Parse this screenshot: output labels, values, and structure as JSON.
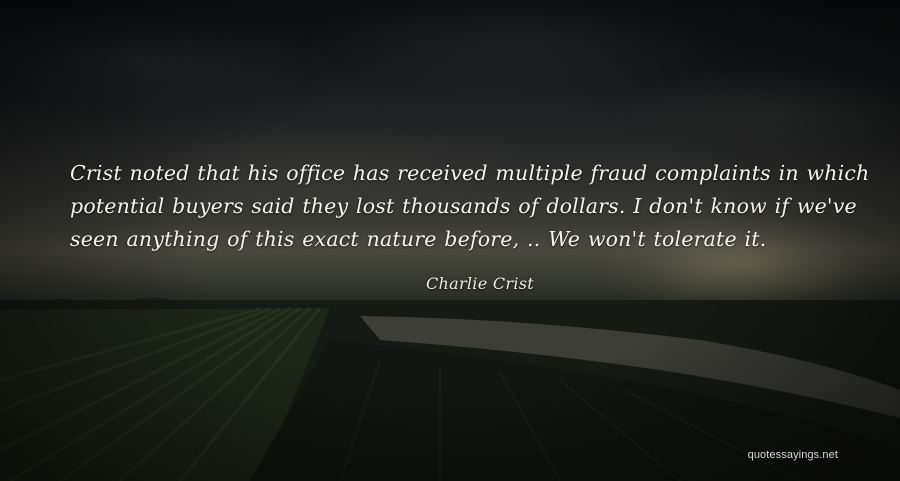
{
  "quote": {
    "text": "Crist noted that his office has received multiple fraud complaints in which potential buyers said they lost thousands of dollars. I don't know if we've seen anything of this exact nature before, .. We won't tolerate it.",
    "author": "Charlie Crist"
  },
  "watermark": "quotessayings.net"
}
